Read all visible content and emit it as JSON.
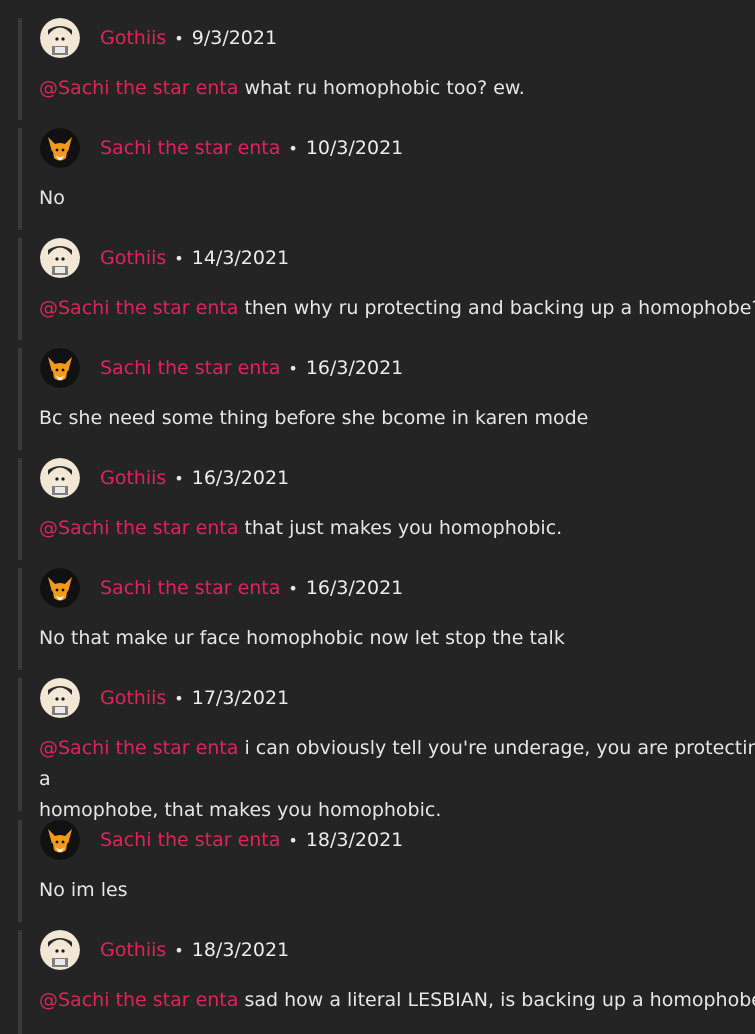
{
  "comments": [
    {
      "author": "Gothiis",
      "separator": "•",
      "date": "9/3/2021",
      "mention": "@Sachi the star enta",
      "text": " what ru homophobic too? ew.",
      "avatar": "gothiis-avatar"
    },
    {
      "author": "Sachi the star enta",
      "separator": "•",
      "date": "10/3/2021",
      "mention": "",
      "text": "No",
      "avatar": "sachi-fox-avatar"
    },
    {
      "author": "Gothiis",
      "separator": "•",
      "date": "14/3/2021",
      "mention": "@Sachi the star enta",
      "text": " then why ru protecting and backing up a homophobe?",
      "avatar": "gothiis-avatar"
    },
    {
      "author": "Sachi the star enta",
      "separator": "•",
      "date": "16/3/2021",
      "mention": "",
      "text": "Bc she need some thing before she bcome in karen mode",
      "avatar": "sachi-fox-avatar"
    },
    {
      "author": "Gothiis",
      "separator": "•",
      "date": "16/3/2021",
      "mention": "@Sachi the star enta",
      "text": " that just makes you homophobic.",
      "avatar": "gothiis-avatar"
    },
    {
      "author": "Sachi the star enta",
      "separator": "•",
      "date": "16/3/2021",
      "mention": "",
      "text": "No that make ur face homophobic now let stop the talk",
      "avatar": "sachi-fox-avatar"
    },
    {
      "author": "Gothiis",
      "separator": "•",
      "date": "17/3/2021",
      "mention": "@Sachi the star enta",
      "text": " i can obviously tell you're underage, you are protecting a\nhomophobe, that makes you homophobic.",
      "avatar": "gothiis-avatar"
    },
    {
      "author": "Sachi the star enta",
      "separator": "•",
      "date": "18/3/2021",
      "mention": "",
      "text": "No im les",
      "avatar": "sachi-fox-avatar"
    },
    {
      "author": "Gothiis",
      "separator": "•",
      "date": "18/3/2021",
      "mention": "@Sachi the star enta",
      "text": " sad how a literal LESBIAN, is backing up a homophobe",
      "avatar": "gothiis-avatar"
    }
  ],
  "colors": {
    "background": "#242424",
    "author": "#e0225e",
    "text": "#e6e6e6",
    "thread_line": "#3a3a3a"
  }
}
